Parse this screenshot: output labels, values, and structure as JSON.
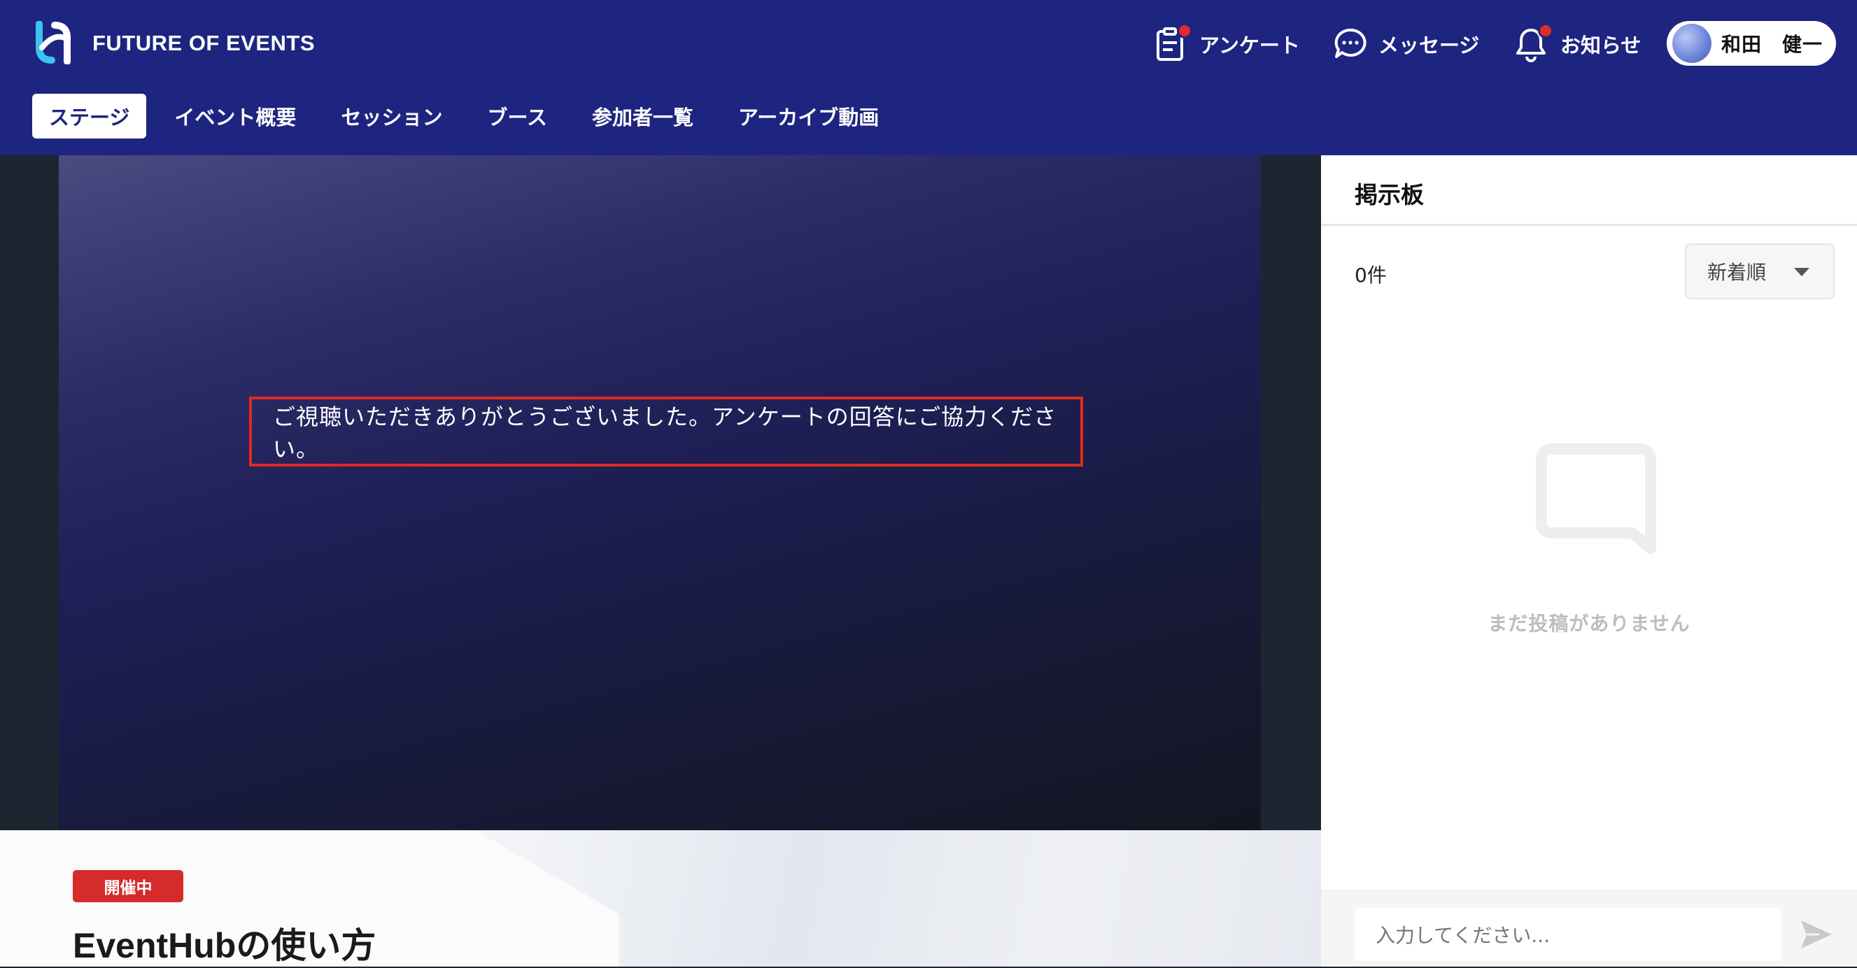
{
  "header": {
    "brand": "FUTURE OF EVENTS",
    "utilities": [
      {
        "label": "アンケート",
        "icon": "clipboard-icon",
        "notification": true
      },
      {
        "label": "メッセージ",
        "icon": "chat-icon",
        "notification": false
      },
      {
        "label": "お知らせ",
        "icon": "bell-icon",
        "notification": true
      }
    ],
    "user": {
      "name": "和田　健一"
    }
  },
  "nav": {
    "tabs": [
      "ステージ",
      "イベント概要",
      "セッション",
      "ブース",
      "参加者一覧",
      "アーカイブ動画"
    ],
    "active": "ステージ"
  },
  "stage": {
    "message": "ご視聴いただきありがとうございました。アンケートの回答にご協力ください。"
  },
  "event": {
    "status": "開催中",
    "title": "EventHubの使い方"
  },
  "board": {
    "title": "掲示板",
    "count": "0件",
    "sort": "新着順",
    "empty": "まだ投稿がありません",
    "placeholder": "入力してください..."
  },
  "colors": {
    "header_bg": "#1e2580",
    "accent_red": "#d62b2b",
    "highlight_border": "#e02b1e"
  }
}
